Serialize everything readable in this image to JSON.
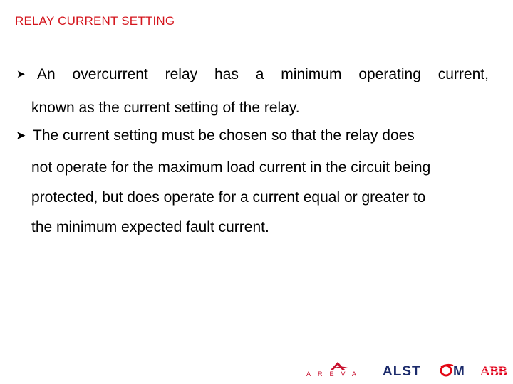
{
  "slide": {
    "title": "RELAY CURRENT SETTING",
    "bullets": [
      {
        "icon": "arrowhead-bullet",
        "lines": [
          "An overcurrent relay has a minimum operating current,",
          "known as the current setting of the relay."
        ]
      },
      {
        "icon": "arrowhead-bullet",
        "lines": [
          "The current setting must be chosen so that the relay does",
          "not operate for the maximum load current in the circuit being",
          "protected, but does operate for a current equal or greater to",
          "the minimum expected fault current."
        ]
      }
    ],
    "first_line_words": [
      "An",
      "overcurrent",
      "relay",
      "has",
      "a",
      "minimum",
      "operating",
      "current,"
    ]
  },
  "footer": {
    "logos": [
      {
        "name": "AREVA",
        "color": "#c8102e"
      },
      {
        "name": "ALSTOM",
        "color": "#1b2a6b",
        "accent": "#e30613"
      },
      {
        "name": "ABB",
        "color": "#e2001a"
      }
    ]
  },
  "colors": {
    "title": "#d4141c",
    "text": "#000000",
    "background": "#ffffff"
  }
}
